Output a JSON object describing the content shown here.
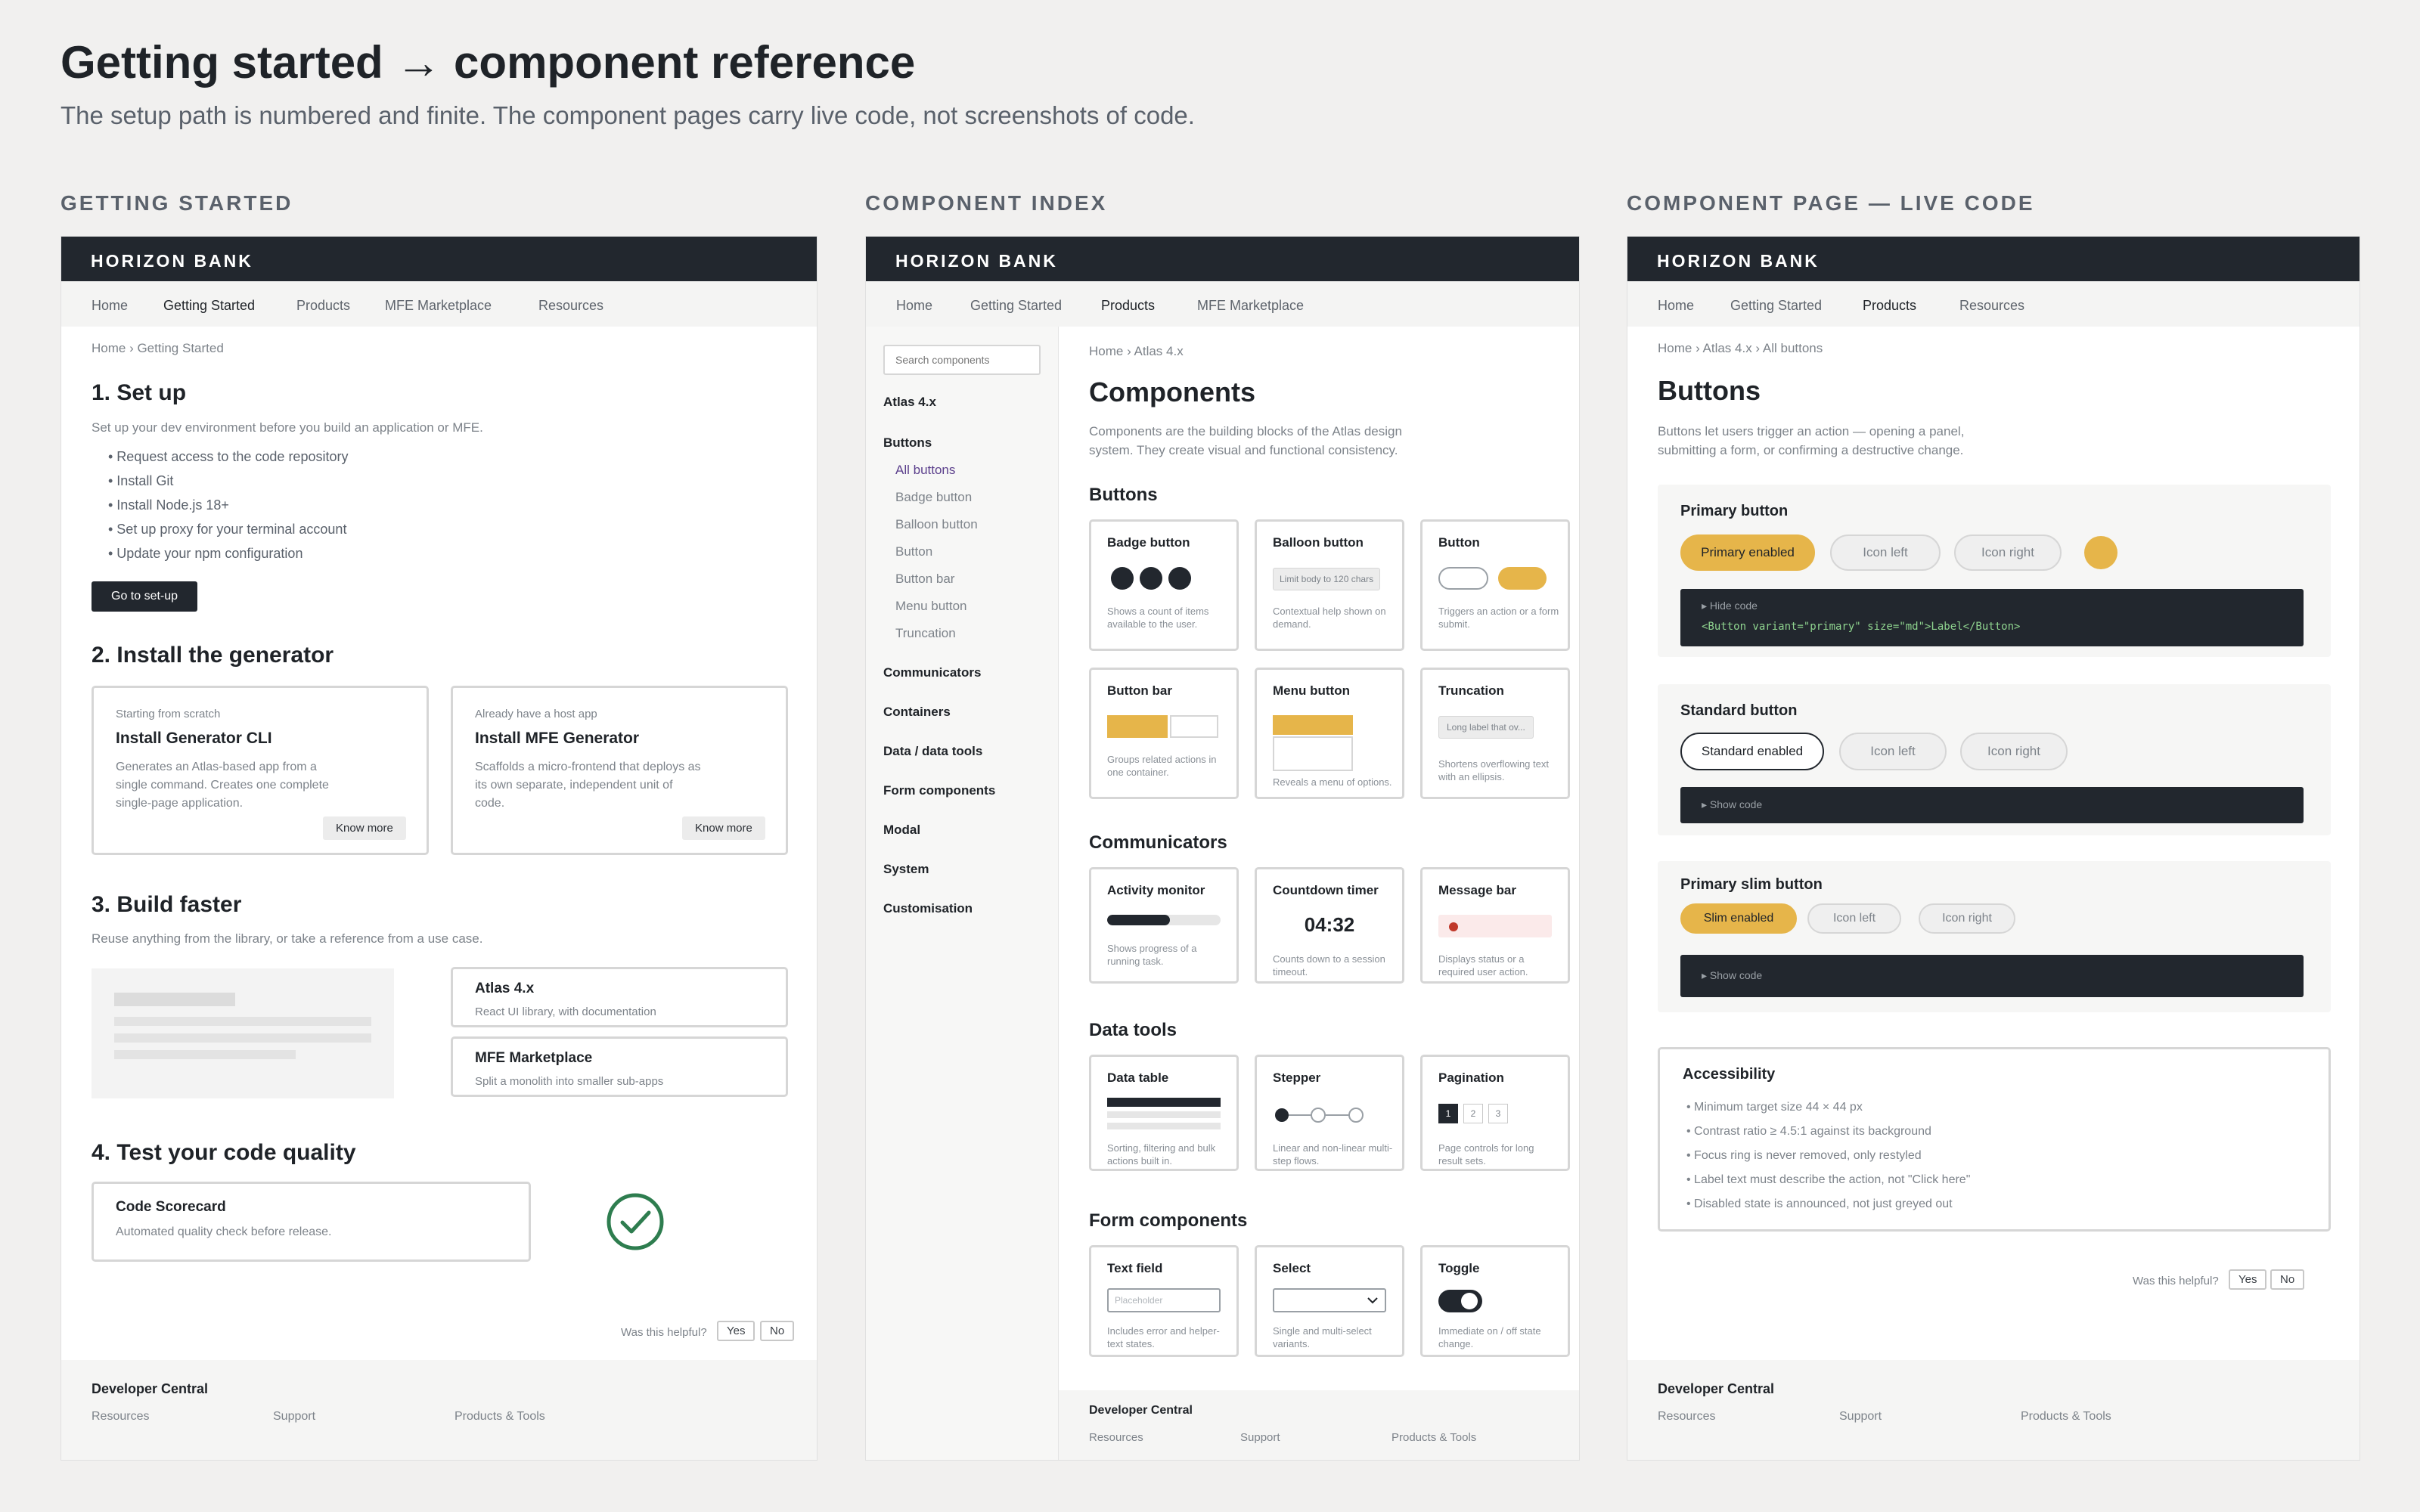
{
  "header": {
    "title": "Getting started → component reference",
    "subtitle": "The setup path is numbered and finite. The component pages carry live code, not screenshots of code."
  },
  "columns": [
    "GETTING STARTED",
    "COMPONENT INDEX",
    "COMPONENT PAGE — LIVE CODE"
  ],
  "brand": "HORIZON BANK",
  "panel1": {
    "nav": [
      "Home",
      "Getting Started",
      "Products",
      "MFE Marketplace",
      "Resources"
    ],
    "breadcrumb": "Home › Getting Started",
    "s1": {
      "title": "1. Set up",
      "text": "Set up your dev environment before you build an application or MFE.",
      "items": [
        "• Request access to the code repository",
        "• Install Git",
        "• Install Node.js 18+",
        "• Set up proxy for your terminal account",
        "• Update your npm configuration"
      ],
      "button": "Go to set-up"
    },
    "s2": {
      "title": "2. Install the generator",
      "cards": [
        {
          "small": "Starting from scratch",
          "title": "Install Generator CLI",
          "desc": "Generates an Atlas-based app from a single command. Creates one complete single-page application.",
          "button": "Know more"
        },
        {
          "small": "Already have a host app",
          "title": "Install MFE Generator",
          "desc": "Scaffolds a micro-frontend that deploys as its own separate, independent unit of code.",
          "button": "Know more"
        }
      ]
    },
    "s3": {
      "title": "3. Build faster",
      "text": "Reuse anything from the library, or take a reference from a use case.",
      "cards": [
        {
          "title": "Atlas 4.x",
          "desc": "React UI library, with documentation"
        },
        {
          "title": "MFE Marketplace",
          "desc": "Split a monolith into smaller sub-apps"
        }
      ]
    },
    "s4": {
      "title": "4. Test your code quality",
      "card": {
        "title": "Code Scorecard",
        "desc": "Automated quality check before release."
      }
    },
    "helpful": "Was this helpful?",
    "yes": "Yes",
    "no": "No",
    "footer": {
      "title": "Developer Central",
      "links": [
        "Resources",
        "Support",
        "Products & Tools"
      ]
    }
  },
  "panel2": {
    "nav": [
      "Home",
      "Getting Started",
      "Products",
      "MFE Marketplace"
    ],
    "search_placeholder": "Search components",
    "side_top": "Atlas 4.x",
    "side_buttons": "Buttons",
    "side_sub": [
      "All buttons",
      "Badge button",
      "Balloon button",
      "Button",
      "Button bar",
      "Menu button",
      "Truncation"
    ],
    "side_more": [
      "Communicators",
      "Containers",
      "Data / data tools",
      "Form components",
      "Modal",
      "System",
      "Customisation"
    ],
    "breadcrumb": "Home › Atlas 4.x",
    "title": "Components",
    "intro": "Components are the building blocks of the Atlas design system. They create visual and functional consistency.",
    "sections": [
      {
        "title": "Buttons",
        "cards": [
          {
            "title": "Badge button",
            "desc": "Shows a count of items available to the user."
          },
          {
            "title": "Balloon button",
            "chip": "Limit body to 120 chars",
            "desc": "Contextual help shown on demand."
          },
          {
            "title": "Button",
            "desc": "Triggers an action or a form submit."
          },
          {
            "title": "Button bar",
            "desc": "Groups related actions in one container."
          },
          {
            "title": "Menu button",
            "desc": "Reveals a menu of options."
          },
          {
            "title": "Truncation",
            "chip": "Long label that ov...",
            "desc": "Shortens overflowing text with an ellipsis."
          }
        ]
      },
      {
        "title": "Communicators",
        "cards": [
          {
            "title": "Activity monitor",
            "desc": "Shows progress of a running task.",
            "progress": 0.55
          },
          {
            "title": "Countdown timer",
            "value": "04:32",
            "desc": "Counts down to a session timeout."
          },
          {
            "title": "Message bar",
            "desc": "Displays status or a required user action."
          }
        ]
      },
      {
        "title": "Data tools",
        "cards": [
          {
            "title": "Data table",
            "desc": "Sorting, filtering and bulk actions built in."
          },
          {
            "title": "Stepper",
            "desc": "Linear and non-linear multi-step flows."
          },
          {
            "title": "Pagination",
            "pages": [
              "1",
              "2",
              "3"
            ],
            "desc": "Page controls for long result sets."
          }
        ]
      },
      {
        "title": "Form components",
        "cards": [
          {
            "title": "Text field",
            "placeholder": "Placeholder",
            "desc": "Includes error and helper-text states."
          },
          {
            "title": "Select",
            "desc": "Single and multi-select variants."
          },
          {
            "title": "Toggle",
            "desc": "Immediate on / off state change."
          }
        ]
      }
    ],
    "footer": {
      "title": "Developer Central",
      "links": [
        "Resources",
        "Support",
        "Products & Tools"
      ]
    }
  },
  "panel3": {
    "nav": [
      "Home",
      "Getting Started",
      "Products",
      "Resources"
    ],
    "breadcrumb": "Home › Atlas 4.x › All buttons",
    "title": "Buttons",
    "intro": "Buttons let users trigger an action — opening a panel, submitting a form, or confirming a destructive change.",
    "primary": {
      "title": "Primary button",
      "buttons": [
        "Primary enabled",
        "Icon left",
        "Icon right"
      ],
      "code_toggle": "Hide code",
      "code": "<Button variant=\"primary\" size=\"md\">Label</Button>"
    },
    "standard": {
      "title": "Standard button",
      "buttons": [
        "Standard enabled",
        "Icon left",
        "Icon right"
      ],
      "code_toggle": "Show code"
    },
    "slim": {
      "title": "Primary slim button",
      "buttons": [
        "Slim enabled",
        "Icon left",
        "Icon right"
      ],
      "code_toggle": "Show code"
    },
    "accessibility": {
      "title": "Accessibility",
      "items": [
        "• Minimum target size 44 × 44 px",
        "• Contrast ratio ≥ 4.5:1 against its background",
        "• Focus ring is never removed, only restyled",
        "• Label text must describe the action, not \"Click here\"",
        "• Disabled state is announced, not just greyed out"
      ]
    },
    "helpful": "Was this helpful?",
    "yes": "Yes",
    "no": "No",
    "footer": {
      "title": "Developer Central",
      "links": [
        "Resources",
        "Support",
        "Products & Tools"
      ]
    }
  },
  "colors": {
    "dark": "#22272e",
    "gold": "#e6b54a",
    "accent": "#5b3f8c",
    "success": "#2e7d4f",
    "alert": "#c0392b"
  }
}
